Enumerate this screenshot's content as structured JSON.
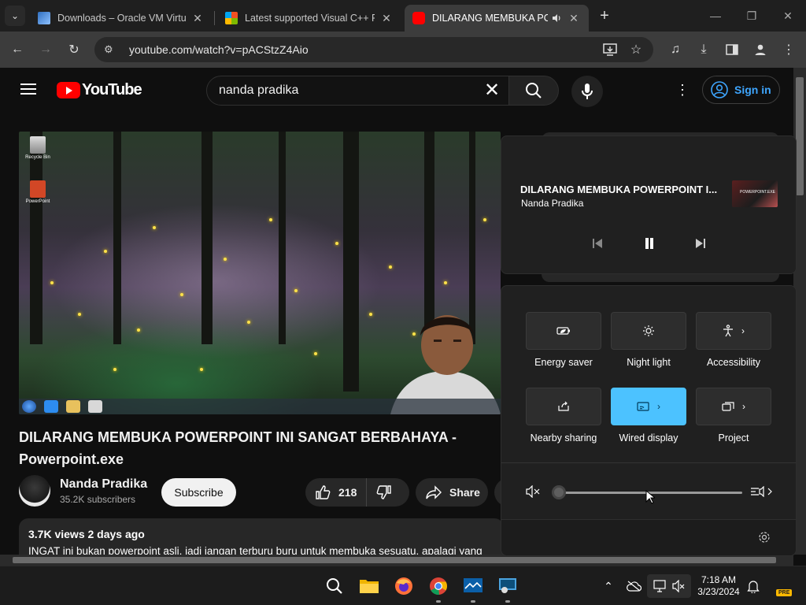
{
  "browser": {
    "tabs": [
      {
        "title": "Downloads – Oracle VM Virtual",
        "close": "✕"
      },
      {
        "title": "Latest supported Visual C++ Re",
        "close": "✕"
      },
      {
        "title": "DILARANG MEMBUKA POW",
        "close": "✕"
      }
    ],
    "new_tab": "+",
    "url": "youtube.com/watch?v=pACStzZ4Aio"
  },
  "youtube": {
    "logo_text": "YouTube",
    "search_value": "nanda pradika",
    "sign_in": "Sign in",
    "video_title": "DILARANG MEMBUKA POWERPOINT INI SANGAT BERBAHAYA - Powerpoint.exe",
    "channel": {
      "name": "Nanda Pradika",
      "subscribers": "35.2K subscribers"
    },
    "subscribe": "Subscribe",
    "likes": "218",
    "share": "Share",
    "description": {
      "meta": "3.7K views  2 days ago",
      "text": "INGAT ini bukan powerpoint asli, jadi jangan terburu buru untuk membuka sesuatu, apalagi yang"
    },
    "video_desktop": {
      "icon1": "Recycle Bin",
      "icon2": "PowerPoint"
    }
  },
  "media_flyout": {
    "title": "DILARANG MEMBUKA POWERPOINT I...",
    "artist": "Nanda Pradika",
    "thumbnail_text": "POWERPOINT.EXE"
  },
  "quick_settings": {
    "tiles": [
      {
        "label": "Energy saver",
        "icon": "leaf-battery-icon",
        "active": false
      },
      {
        "label": "Night light",
        "icon": "brightness-icon",
        "active": false
      },
      {
        "label": "Accessibility",
        "icon": "accessibility-icon",
        "active": false
      },
      {
        "label": "Nearby sharing",
        "icon": "share-icon",
        "active": false
      },
      {
        "label": "Wired display",
        "icon": "cast-icon",
        "active": true
      },
      {
        "label": "Project",
        "icon": "project-icon",
        "active": false
      }
    ],
    "volume_level": 0,
    "accent": "#4cc2ff"
  },
  "taskbar": {
    "time": "7:18 AM",
    "date": "3/23/2024",
    "badge": "PRE"
  }
}
